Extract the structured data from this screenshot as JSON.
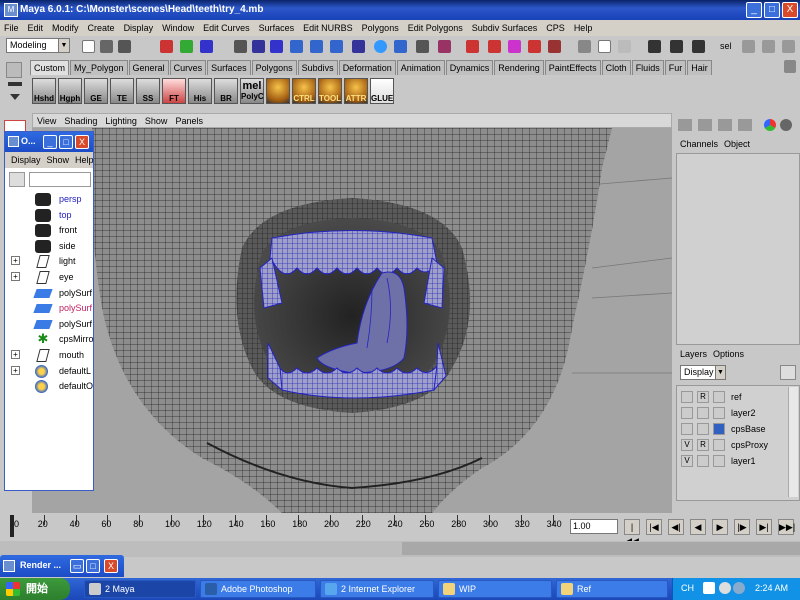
{
  "window": {
    "title": "Maya 6.0.1: C:\\Monster\\scenes\\Head\\teeth\\try_4.mb",
    "min": "_",
    "max": "□",
    "close": "X"
  },
  "menubar": [
    "File",
    "Edit",
    "Modify",
    "Create",
    "Display",
    "Window",
    "Edit Curves",
    "Surfaces",
    "Edit NURBS",
    "Polygons",
    "Edit Polygons",
    "Subdiv Surfaces",
    "CPS",
    "Help"
  ],
  "toolbar": {
    "mode": "Modeling",
    "sel_label": "sel"
  },
  "shelf_tabs": [
    "Custom",
    "My_Polygon",
    "General",
    "Curves",
    "Surfaces",
    "Polygons",
    "Subdivs",
    "Deformation",
    "Animation",
    "Dynamics",
    "Rendering",
    "PaintEffects",
    "Cloth",
    "Fluids",
    "Fur",
    "Hair"
  ],
  "shelf_buttons": [
    "Hshd",
    "Hgph",
    "GE",
    "TE",
    "SS",
    "FT",
    "His",
    "BR",
    "PolyC",
    "",
    "CTRL",
    "TOOL",
    "ATTR",
    "GLUE"
  ],
  "shelf_mel": "mel",
  "outliner": {
    "title": "O...",
    "menu": [
      "Display",
      "Show",
      "Help"
    ],
    "items": [
      {
        "label": "persp",
        "style": "blue",
        "icon": "camera-icon",
        "expand": false
      },
      {
        "label": "top",
        "style": "blue",
        "icon": "camera-icon",
        "expand": false
      },
      {
        "label": "front",
        "style": "normal",
        "icon": "camera-icon",
        "expand": false
      },
      {
        "label": "side",
        "style": "normal",
        "icon": "camera-icon",
        "expand": false
      },
      {
        "label": "light",
        "style": "normal",
        "icon": "nurbs-curve-icon",
        "expand": true
      },
      {
        "label": "eye",
        "style": "normal",
        "icon": "nurbs-curve-icon",
        "expand": true
      },
      {
        "label": "polySurf",
        "style": "normal",
        "icon": "poly-mesh-icon",
        "expand": false
      },
      {
        "label": "polySurf",
        "style": "sel",
        "icon": "poly-mesh-icon",
        "expand": false
      },
      {
        "label": "polySurf",
        "style": "normal",
        "icon": "poly-mesh-icon",
        "expand": false
      },
      {
        "label": "cpsMirro",
        "style": "normal",
        "icon": "joint-star-icon",
        "expand": false
      },
      {
        "label": "mouth",
        "style": "normal",
        "icon": "nurbs-curve-icon",
        "expand": true
      },
      {
        "label": "defaultL",
        "style": "normal",
        "icon": "set-icon",
        "expand": true
      },
      {
        "label": "defaultO",
        "style": "normal",
        "icon": "set-icon",
        "expand": false
      }
    ]
  },
  "viewport": {
    "menu": [
      "View",
      "Shading",
      "Lighting",
      "Show",
      "Panels"
    ]
  },
  "channels": {
    "header": [
      "Channels",
      "Object"
    ]
  },
  "layers": {
    "header": [
      "Layers",
      "Options"
    ],
    "display": "Display",
    "rows": [
      {
        "v": "",
        "r": "R",
        "swatch": "none",
        "name": "ref"
      },
      {
        "v": "",
        "r": "",
        "swatch": "none",
        "name": "layer2"
      },
      {
        "v": "",
        "r": "",
        "swatch": "blue",
        "name": "cpsBase"
      },
      {
        "v": "V",
        "r": "R",
        "swatch": "none",
        "name": "cpsProxy"
      },
      {
        "v": "V",
        "r": "",
        "swatch": "none",
        "name": "layer1"
      }
    ]
  },
  "timeline": {
    "ticks": [
      "0",
      "20",
      "40",
      "60",
      "80",
      "100",
      "120",
      "140",
      "160",
      "180",
      "200",
      "220",
      "240",
      "260",
      "280",
      "300",
      "320",
      "340"
    ],
    "current_frame": "1.00",
    "playback": [
      "|◀◀",
      "|◀",
      "◀|",
      "◀",
      "▶",
      "|▶",
      "▶|",
      "▶▶|"
    ]
  },
  "render_window": {
    "title": "Render ..."
  },
  "taskbar": {
    "start": "開始",
    "tasks": [
      {
        "label": "2 Maya",
        "active": true
      },
      {
        "label": "Adobe Photoshop",
        "active": false
      },
      {
        "label": "2 Internet Explorer",
        "active": false
      },
      {
        "label": "WIP",
        "active": false
      },
      {
        "label": "Ref",
        "active": false
      }
    ],
    "lang": "CH",
    "clock": "2:24 AM"
  }
}
